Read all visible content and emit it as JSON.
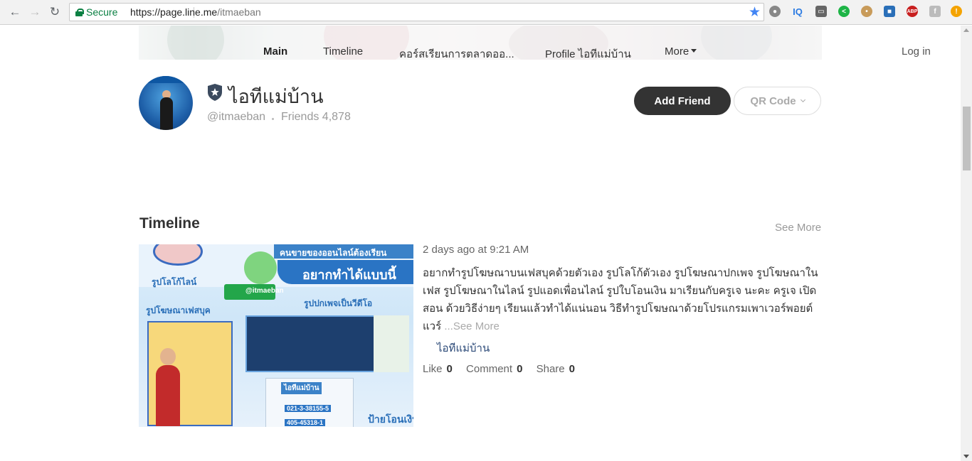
{
  "browser": {
    "secure_label": "Secure",
    "url_host": "https://page.line.me",
    "url_path": "/itmaeban"
  },
  "extensions": [
    "translate-icon",
    "iq-icon",
    "line-icon",
    "share-icon",
    "cookie-icon",
    "clipboard-icon",
    "abp-icon",
    "facebook-icon",
    "alert-icon"
  ],
  "nav": {
    "tabs": [
      {
        "label": "Main",
        "active": true
      },
      {
        "label": "Timeline",
        "active": false
      },
      {
        "label": "คอร์สเรียนการตลาดออ...",
        "active": false
      },
      {
        "label": "Profile ไอทีแม่บ้าน",
        "active": false
      },
      {
        "label": "More",
        "active": false
      }
    ],
    "login": "Log in"
  },
  "profile": {
    "name": "ไอทีแม่บ้าน",
    "handle": "@itmaeban",
    "friends": "Friends 4,878",
    "add_friend": "Add Friend",
    "qr_code": "QR Code"
  },
  "timeline": {
    "title": "Timeline",
    "see_more": "See More",
    "post": {
      "time": "2 days ago at 9:21 AM",
      "text": "อยากทำรูปโฆษณาบนเฟสบุคด้วยตัวเอง รูปโลโก้ตัวเอง รูปโฆษณาปกเพจ รูปโฆษณาในเฟส รูปโฆษณาในไลน์ รูปแอดเพื่อนไลน์ รูปใบโอนเงิน มาเรียนกับครูเจ นะคะ ครูเจ เปิดสอน ด้วยวิธีง่ายๆ เรียนแล้วทำได้แน่นอน วิธีทำรูปโฆษณาด้วยโปรแกรมเพาเวอร์พอยต์ แวร์",
      "more": "...See More",
      "author": "ไอทีแม่บ้าน",
      "like_label": "Like",
      "like_count": "0",
      "comment_label": "Comment",
      "comment_count": "0",
      "share_label": "Share",
      "share_count": "0"
    },
    "thumbnail_text": {
      "headline": "คนขายของออนไลน์ต้องเรียน",
      "banner": "อยากทำได้แบบนี้",
      "logo_label": "รูปโลโก้ไลน์",
      "ad_label": "รูปโฆษณาเฟสบุค",
      "cover_label": "รูปปกเพจเป็นวีดีโอ",
      "handle_tag": "@itmaeban",
      "card_title": "ไอทีแม่บ้าน",
      "phone_1": "021-3-38155-5",
      "phone_2": "405-45318-1",
      "transfer_label": "ป้ายโอนเงิน"
    }
  },
  "colors": {
    "add_friend_bg": "#333333",
    "secure_green": "#0b8043",
    "star_blue": "#4285f4"
  }
}
